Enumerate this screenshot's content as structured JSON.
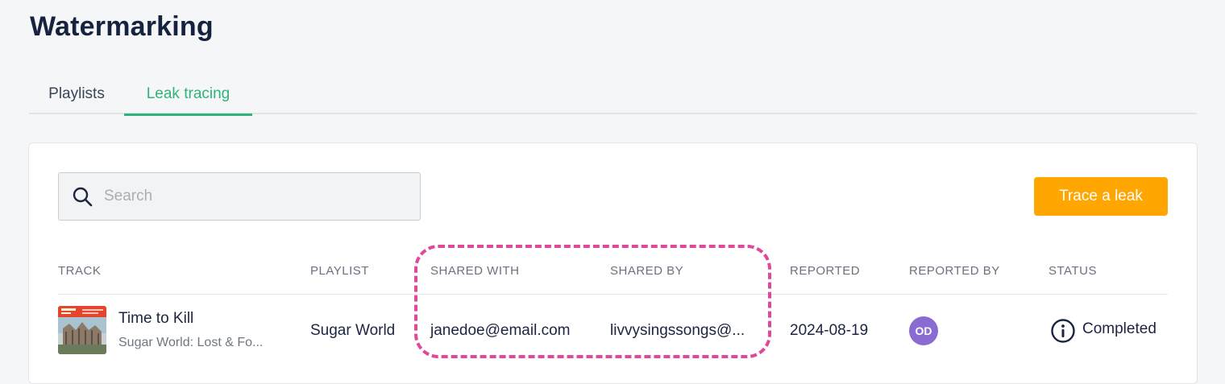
{
  "page": {
    "title": "Watermarking"
  },
  "tabs": [
    {
      "label": "Playlists",
      "active": false
    },
    {
      "label": "Leak tracing",
      "active": true
    }
  ],
  "toolbar": {
    "search_placeholder": "Search",
    "search_icon": "search-icon",
    "trace_button_label": "Trace a leak"
  },
  "table": {
    "columns": [
      "TRACK",
      "PLAYLIST",
      "SHARED WITH",
      "SHARED BY",
      "REPORTED",
      "REPORTED BY",
      "STATUS"
    ],
    "rows": [
      {
        "track_title": "Time to Kill",
        "track_subtitle": "Sugar World: Lost & Fo...",
        "playlist": "Sugar World",
        "shared_with": "janedoe@email.com",
        "shared_by": "livvysingssongs@...",
        "reported": "2024-08-19",
        "reported_by_initials": "OD",
        "status": "Completed",
        "status_icon": "info-icon"
      }
    ]
  },
  "colors": {
    "accent_green": "#2fb37a",
    "button_orange": "#ffa600",
    "avatar_purple": "#8a6bd1",
    "highlight_pink": "#e0489a"
  }
}
